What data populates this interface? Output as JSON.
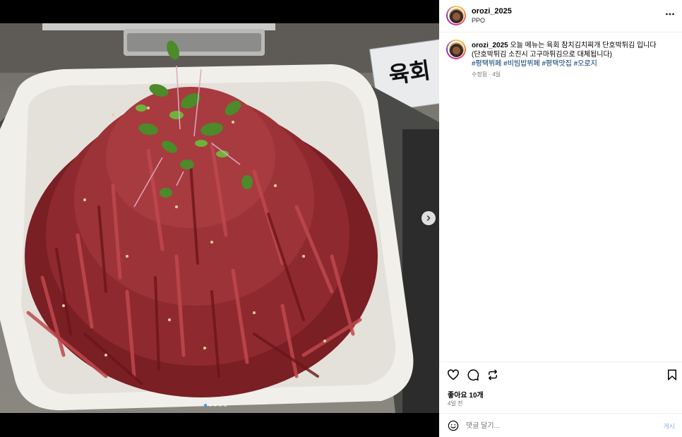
{
  "post": {
    "username": "orozi_2025",
    "subtitle": "PPO",
    "caption_user": "orozi_2025",
    "caption_line1": "오늘 메뉴는 육회 참치김치찌개 단호박튀김 입니다",
    "caption_line2": "(단호박튀김 소진시 고구마튀김으로 대체됩니다)",
    "hashtags": [
      "#평택뷔페",
      "#비빔밥뷔페",
      "#평택맛집",
      "#오로지"
    ],
    "caption_meta": "수정됨 · 4일",
    "likes": "좋아요 10개",
    "time_ago": "4일 전"
  },
  "media": {
    "sign_text": "육회",
    "carousel_count": 5,
    "active_index": 0
  },
  "comment": {
    "placeholder": "댓글 달기...",
    "post_label": "게시"
  },
  "icons": [
    "more-icon",
    "heart-icon",
    "comment-icon",
    "repost-icon",
    "bookmark-icon",
    "emoji-icon",
    "chevron-right-icon"
  ],
  "colors": {
    "hashtag": "#00376b",
    "meta": "#737373",
    "post_disabled": "#8fb8e8",
    "active_dot": "#3897f0"
  }
}
